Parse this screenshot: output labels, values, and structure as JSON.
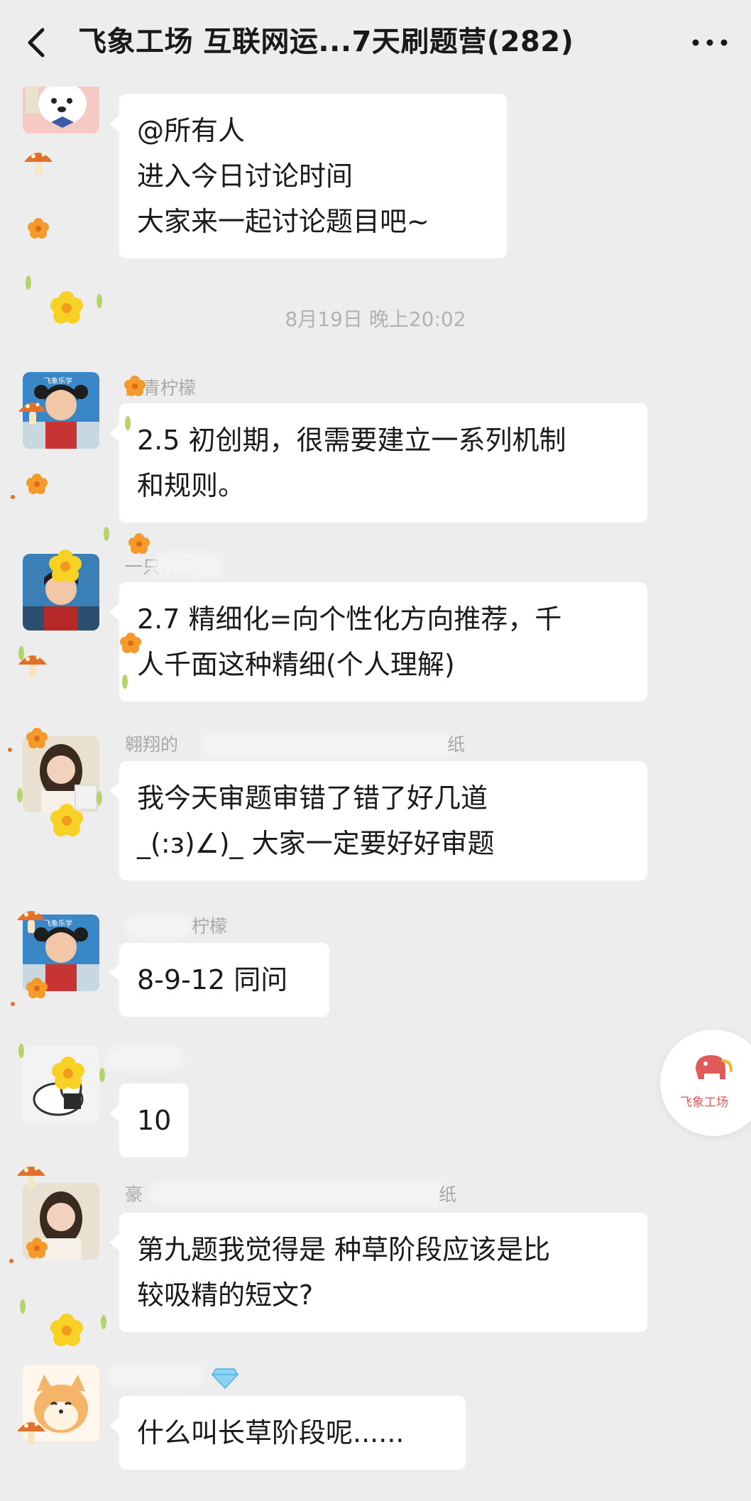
{
  "header": {
    "title": "飞象工场 互联网运...7天刷题营(282)",
    "back_icon": "chevron-left-icon",
    "more_icon": "more-dots-icon"
  },
  "messages": [
    {
      "id": "m0",
      "sender": "",
      "lines": [
        "@所有人",
        "进入今日讨论时间",
        "大家来一起讨论题目吧~"
      ]
    },
    {
      "id": "m1",
      "sender": "只青柠檬",
      "lines": [
        "2.5 初创期，很需要建立一系列机制",
        "和规则。"
      ]
    },
    {
      "id": "m2",
      "sender": "一只柠檬",
      "lines": [
        "2.7 精细化=向个性化方向推荐，千",
        "人千面这种精细(个人理解)"
      ]
    },
    {
      "id": "m3",
      "sender": "翱翔的",
      "sender_tail": "纸",
      "lines": [
        "我今天审题审错了错了好几道",
        "_(:з)∠)_ 大家一定要好好审题"
      ]
    },
    {
      "id": "m4",
      "sender": "柠檬",
      "lines": [
        "8-9-12 同问"
      ]
    },
    {
      "id": "m5",
      "sender": "",
      "lines": [
        "10"
      ]
    },
    {
      "id": "m6",
      "sender": "豪",
      "sender_tail": "纸",
      "lines": [
        "第九题我觉得是 种草阶段应该是比",
        "较吸精的短文?"
      ]
    },
    {
      "id": "m7",
      "sender": "",
      "lines": [
        "什么叫长草阶段呢......"
      ]
    }
  ],
  "timestamp": "8月19日 晚上20:02",
  "floating_logo": {
    "text": "飞象工场",
    "icon": "elephant-logo-icon"
  },
  "colors": {
    "background": "#ededed",
    "bubble": "#ffffff",
    "flower_yellow": "#f7d225",
    "flower_orange": "#f39a2b",
    "mushroom_red": "#e2702a"
  }
}
